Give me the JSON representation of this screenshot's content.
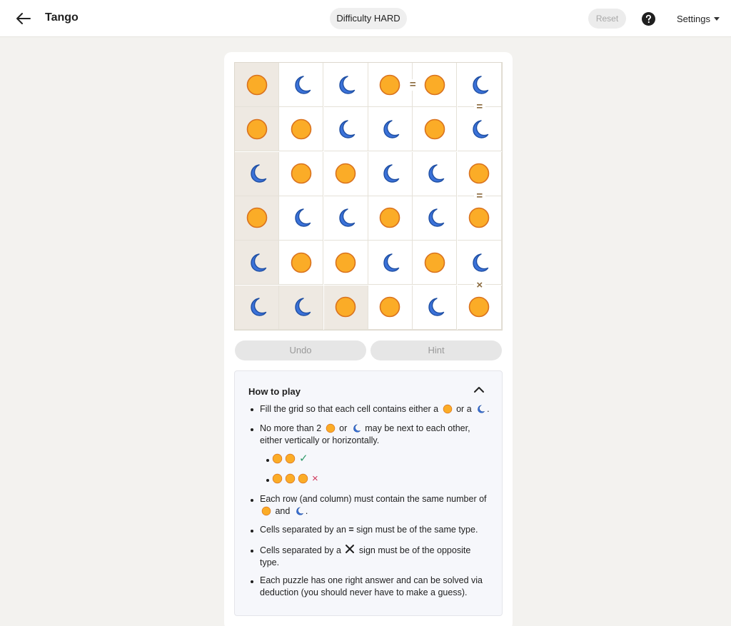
{
  "header": {
    "title": "Tango",
    "difficulty": "Difficulty HARD",
    "reset_label": "Reset",
    "settings_label": "Settings",
    "back_icon": "arrow-left-icon",
    "help_icon": "question-circle-icon"
  },
  "colors": {
    "sun": "#fbac27",
    "sun_border": "#d9721e",
    "moon": "#3b72d9",
    "moon_border": "#1f4fa3",
    "locked_cell": "#eee9e2",
    "constraint": "#8a6a3d"
  },
  "board": {
    "size": 6,
    "cells": [
      [
        "sun",
        "moon",
        "moon",
        "sun",
        "sun",
        "moon"
      ],
      [
        "sun",
        "sun",
        "moon",
        "moon",
        "sun",
        "moon"
      ],
      [
        "moon",
        "sun",
        "sun",
        "moon",
        "moon",
        "sun"
      ],
      [
        "sun",
        "moon",
        "moon",
        "sun",
        "moon",
        "sun"
      ],
      [
        "moon",
        "sun",
        "sun",
        "moon",
        "sun",
        "moon"
      ],
      [
        "moon",
        "moon",
        "sun",
        "sun",
        "moon",
        "sun"
      ]
    ],
    "locked": [
      [
        true,
        false,
        false,
        false,
        false,
        false
      ],
      [
        true,
        false,
        false,
        false,
        false,
        false
      ],
      [
        true,
        false,
        false,
        false,
        false,
        false
      ],
      [
        true,
        false,
        false,
        false,
        false,
        false
      ],
      [
        true,
        false,
        false,
        false,
        false,
        false
      ],
      [
        true,
        true,
        true,
        false,
        false,
        false
      ]
    ],
    "constraints": [
      {
        "type": "=",
        "between": [
          [
            0,
            3
          ],
          [
            0,
            4
          ]
        ]
      },
      {
        "type": "=",
        "between": [
          [
            0,
            5
          ],
          [
            1,
            5
          ]
        ]
      },
      {
        "type": "=",
        "between": [
          [
            2,
            5
          ],
          [
            3,
            5
          ]
        ]
      },
      {
        "type": "×",
        "between": [
          [
            4,
            5
          ],
          [
            5,
            5
          ]
        ]
      }
    ]
  },
  "actions": {
    "undo_label": "Undo",
    "hint_label": "Hint"
  },
  "how_to_play": {
    "title": "How to play",
    "collapse_icon": "chevron-up-icon",
    "rule1_a": "Fill the grid so that each cell contains either a",
    "rule1_b": "or a",
    "rule1_c": ".",
    "rule2_a": "No more than 2",
    "rule2_b": "or",
    "rule2_c": "may be next to each other,",
    "rule2_d": "either vertically or horizontally.",
    "example_ok_mark": "✓",
    "example_bad_mark": "×",
    "rule3_a": "Each row (and column) must contain the same number of",
    "rule3_b": "and",
    "rule3_c": ".",
    "rule4_a": "Cells separated by an",
    "rule4_sym": "=",
    "rule4_b": "sign must be of the same type.",
    "rule5_a": "Cells separated by a",
    "rule5_b": "sign must be of the opposite",
    "rule5_c": "type.",
    "rule6_a": "Each puzzle has one right answer and can be solved via",
    "rule6_b": "deduction (you should never have to make a guess)."
  }
}
